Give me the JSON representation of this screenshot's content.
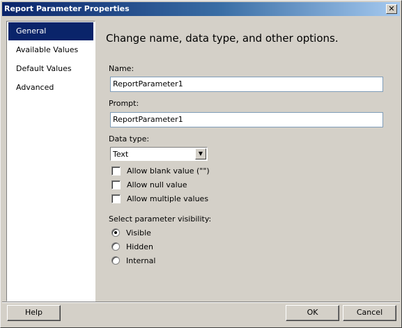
{
  "window": {
    "title": "Report Parameter Properties",
    "close_label": "✕"
  },
  "sidebar": {
    "items": [
      {
        "label": "General",
        "selected": true
      },
      {
        "label": "Available Values",
        "selected": false
      },
      {
        "label": "Default Values",
        "selected": false
      },
      {
        "label": "Advanced",
        "selected": false
      }
    ]
  },
  "main": {
    "heading": "Change name, data type, and other options.",
    "name": {
      "label": "Name:",
      "value": "ReportParameter1"
    },
    "prompt": {
      "label": "Prompt:",
      "value": "ReportParameter1"
    },
    "data_type": {
      "label": "Data type:",
      "value": "Text",
      "arrow": "▼"
    },
    "options": [
      {
        "label": "Allow blank value (\"\")",
        "checked": false
      },
      {
        "label": "Allow null value",
        "checked": false
      },
      {
        "label": "Allow multiple values",
        "checked": false
      }
    ],
    "visibility": {
      "label": "Select parameter visibility:",
      "options": [
        {
          "label": "Visible",
          "checked": true
        },
        {
          "label": "Hidden",
          "checked": false
        },
        {
          "label": "Internal",
          "checked": false
        }
      ]
    }
  },
  "footer": {
    "help_label": "Help",
    "ok_label": "OK",
    "cancel_label": "Cancel"
  }
}
